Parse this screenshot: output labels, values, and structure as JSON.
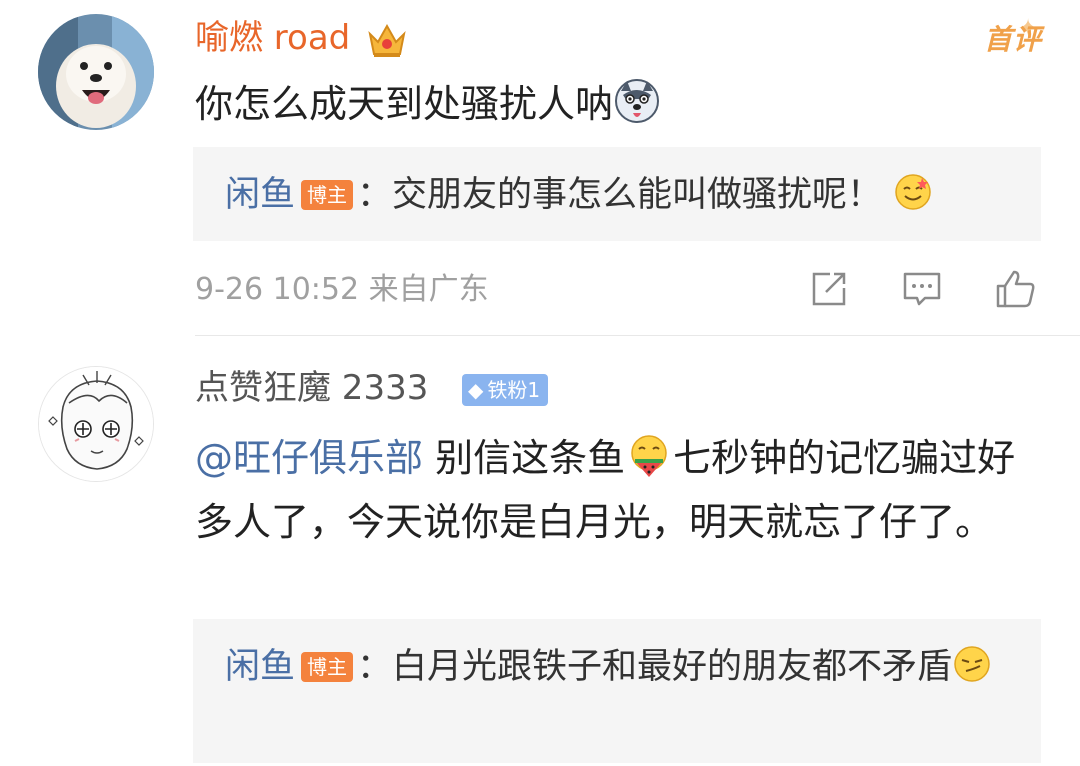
{
  "comments": [
    {
      "username": "喻燃 road",
      "badge": "首评",
      "text": "你怎么成天到处骚扰人呐",
      "reply": {
        "user": "闲鱼",
        "role_badge": "博主",
        "sep": "：",
        "text": "交朋友的事怎么能叫做骚扰呢！"
      },
      "time": "9-26 10:52",
      "location": "来自广东"
    },
    {
      "username": "点赞狂魔 2333",
      "fan_badge": "铁粉1",
      "mention": "@旺仔俱乐部",
      "text_part1": " 别信这条鱼",
      "text_part2": "七秒钟的记忆骗过好多人了，今天说你是白月光，明天就忘了仔了。",
      "reply": {
        "user": "闲鱼",
        "role_badge": "博主",
        "sep": "：",
        "text": "白月光跟铁子和最好的朋友都不矛盾"
      }
    }
  ],
  "colors": {
    "username_orange": "#e8662a",
    "link_blue": "#4a6fa5",
    "badge_orange": "#f4823d",
    "fan_blue": "#8ab4ef"
  },
  "icons": [
    "crown-icon",
    "dog-face-emoji",
    "share-icon",
    "comment-icon",
    "like-icon",
    "grin-emoji",
    "watermelon-emoji",
    "smug-emoji"
  ]
}
